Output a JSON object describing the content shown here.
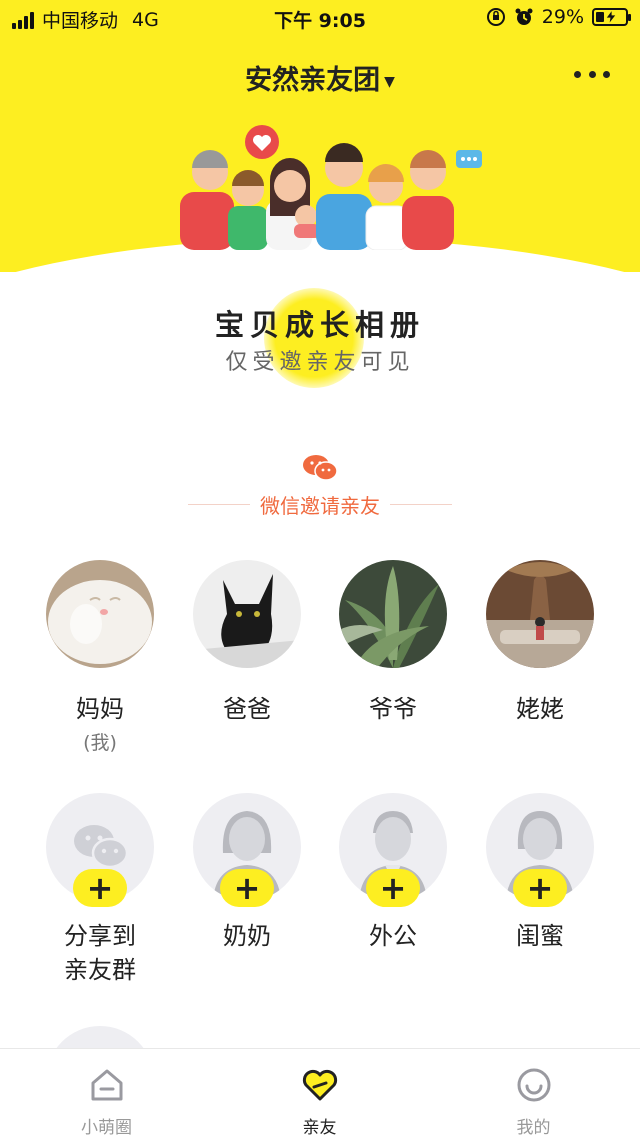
{
  "status_bar": {
    "carrier": "中国移动",
    "network": "4G",
    "time": "下午 9:05",
    "battery": "29%",
    "battery_level": 0.29
  },
  "header": {
    "group_name": "安然亲友团"
  },
  "album": {
    "title": "宝贝成长相册",
    "subtitle": "仅受邀亲友可见"
  },
  "invite": {
    "label": "微信邀请亲友"
  },
  "members": [
    {
      "name": "妈妈",
      "note": "(我)",
      "photo": "white-cat-photo"
    },
    {
      "name": "爸爸",
      "note": "",
      "photo": "black-cat-photo"
    },
    {
      "name": "爷爷",
      "note": "",
      "photo": "green-plant-photo"
    },
    {
      "name": "姥姥",
      "note": "",
      "photo": "hotel-lobby-photo"
    }
  ],
  "invite_slots": [
    {
      "name": "分享到\n亲友群",
      "line1": "分享到",
      "line2": "亲友群",
      "icon": "wechat-icon"
    },
    {
      "name": "奶奶",
      "icon": "female-silhouette-icon"
    },
    {
      "name": "外公",
      "icon": "male-silhouette-icon"
    },
    {
      "name": "闺蜜",
      "icon": "female-silhouette-icon"
    }
  ],
  "plus_symbol": "+",
  "bottom_nav": {
    "items": [
      {
        "label": "小萌圈",
        "icon": "home-icon",
        "active": false
      },
      {
        "label": "亲友",
        "icon": "heart-icon",
        "active": true
      },
      {
        "label": "我的",
        "icon": "smiley-icon",
        "active": false
      }
    ]
  },
  "colors": {
    "brand_yellow": "#fdee21",
    "invite_orange": "#f06a3f",
    "slot_gray": "#eeeef2"
  }
}
